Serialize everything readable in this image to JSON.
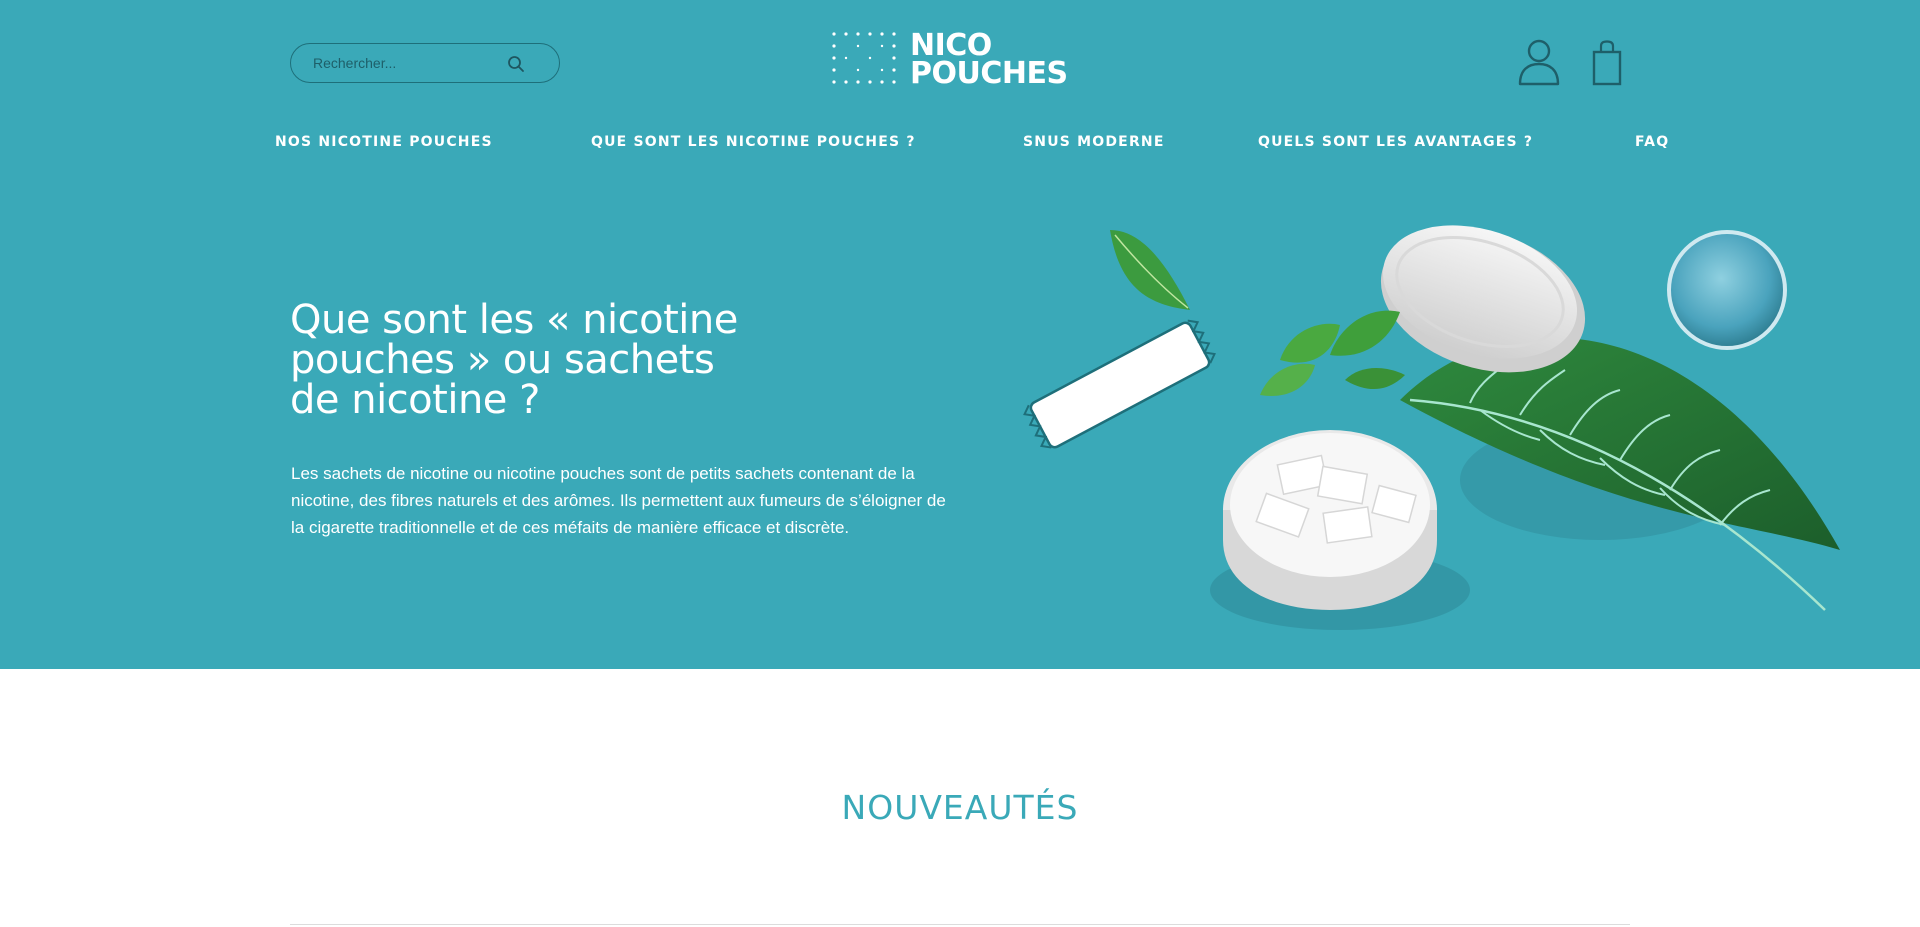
{
  "header": {
    "search": {
      "placeholder": "Rechercher...",
      "icon": "search-icon"
    },
    "logo": {
      "line1": "NICO",
      "line2": "POUCHES"
    },
    "icons": [
      "user-icon",
      "shopping-bag-icon"
    ]
  },
  "nav": {
    "items": [
      {
        "label": "NOS NICOTINE POUCHES"
      },
      {
        "label": "QUE SONT LES NICOTINE POUCHES ?"
      },
      {
        "label": "SNUS MODERNE"
      },
      {
        "label": "QUELS SONT LES AVANTAGES ?"
      },
      {
        "label": "FAQ"
      }
    ]
  },
  "hero": {
    "title": "Que sont les « nicotine pouches » ou sachets de nicotine ?",
    "description": "Les sachets de nicotine ou nicotine pouches sont de petits sachets contenant de la nicotine, des fibres naturels et des arômes. Ils permettent aux fumeurs de s’éloigner de la cigarette traditionnelle et de ces méfaits de manière efficace et discrète."
  },
  "new_section": {
    "title": "NOUVEAUTÉS"
  },
  "colors": {
    "brand_teal": "#3aa9b8",
    "dark_teal": "#1e6f7a",
    "white": "#ffffff"
  }
}
